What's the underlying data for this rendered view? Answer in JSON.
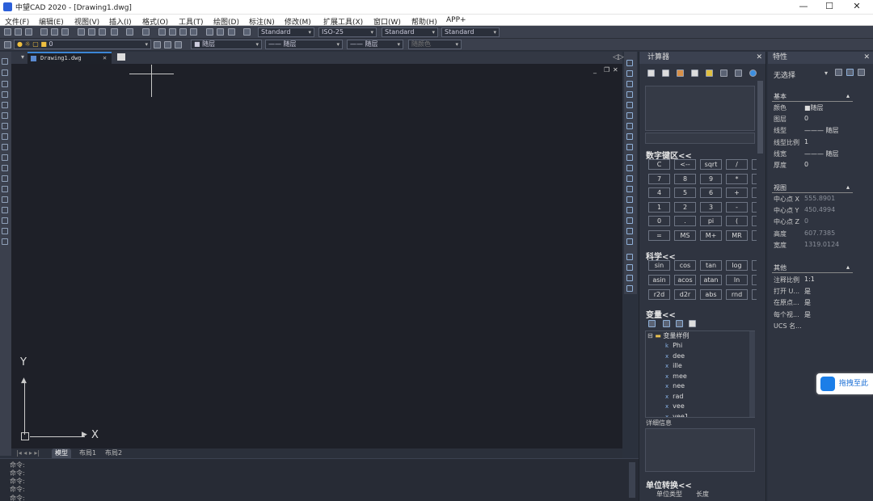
{
  "app": {
    "title": "中望CAD 2020 - [Drawing1.dwg]",
    "window_controls": [
      "—",
      "☐",
      "✕"
    ]
  },
  "menu": [
    "文件(F)",
    "编辑(E)",
    "视图(V)",
    "插入(I)",
    "格式(O)",
    "工具(T)",
    "绘图(D)",
    "标注(N)",
    "修改(M)",
    "扩展工具(X)",
    "窗口(W)",
    "帮助(H)",
    "APP+"
  ],
  "toolbar": {
    "textstyle": "Standard",
    "dimstyle": "ISO-25",
    "tablestyle": "Standard",
    "mleaderstyle": "Standard",
    "layer": "0",
    "color": "随层",
    "linetype": "—— 随层",
    "lineweight": "—— 随层",
    "plotstyle": "随颜色"
  },
  "drawing": {
    "tab": "Drawing1.dwg",
    "ucs_x": "X",
    "ucs_y": "Y",
    "layout_tabs": [
      "模型",
      "布局1",
      "布局2"
    ]
  },
  "command_lines": [
    "命令:",
    "命令:",
    "命令:",
    "命令:",
    "命令:"
  ],
  "calculator": {
    "title": "计算器",
    "numpad_title": "数字键区<<",
    "numpad": [
      [
        "C",
        "<--",
        "sqrt",
        "/"
      ],
      [
        "7",
        "8",
        "9",
        "*"
      ],
      [
        "4",
        "5",
        "6",
        "+"
      ],
      [
        "1",
        "2",
        "3",
        "-"
      ],
      [
        "0",
        ".",
        "pi",
        "("
      ],
      [
        "=",
        "MS",
        "M+",
        "MR"
      ]
    ],
    "sci_title": "科学<<",
    "sci": [
      [
        "sin",
        "cos",
        "tan",
        "log"
      ],
      [
        "asin",
        "acos",
        "atan",
        "ln"
      ],
      [
        "r2d",
        "d2r",
        "abs",
        "rnd"
      ]
    ],
    "vars_title": "变量<<",
    "var_folder": "变量样例",
    "vars": [
      {
        "k": "k",
        "n": "Phi"
      },
      {
        "k": "x",
        "n": "dee"
      },
      {
        "k": "x",
        "n": "ille"
      },
      {
        "k": "x",
        "n": "mee"
      },
      {
        "k": "x",
        "n": "nee"
      },
      {
        "k": "x",
        "n": "rad"
      },
      {
        "k": "x",
        "n": "vee"
      },
      {
        "k": "x",
        "n": "vee1"
      }
    ],
    "detail_label": "详细信息",
    "unit_title": "单位转换<<",
    "unit_type_label": "单位类型",
    "unit_type_value": "长度"
  },
  "properties": {
    "title": "特性",
    "selection": "无选择",
    "basic_title": "基本",
    "basic": [
      {
        "l": "颜色",
        "v": "■随层"
      },
      {
        "l": "图层",
        "v": "0"
      },
      {
        "l": "线型",
        "v": "——— 随层"
      },
      {
        "l": "线型比例",
        "v": "1"
      },
      {
        "l": "线宽",
        "v": "——— 随层"
      },
      {
        "l": "厚度",
        "v": "0"
      }
    ],
    "view_title": "视图",
    "view": [
      {
        "l": "中心点 X",
        "v": "555.8901"
      },
      {
        "l": "中心点 Y",
        "v": "450.4994"
      },
      {
        "l": "中心点 Z",
        "v": "0"
      },
      {
        "l": "高度",
        "v": "607.7385"
      },
      {
        "l": "宽度",
        "v": "1319.0124"
      }
    ],
    "other_title": "其他",
    "other": [
      {
        "l": "注释比例",
        "v": "1:1"
      },
      {
        "l": "打开 U...",
        "v": "是"
      },
      {
        "l": "在原点...",
        "v": "是"
      },
      {
        "l": "每个视...",
        "v": "是"
      },
      {
        "l": "UCS 名...",
        "v": ""
      }
    ]
  },
  "cloud_button": "拖拽至此"
}
